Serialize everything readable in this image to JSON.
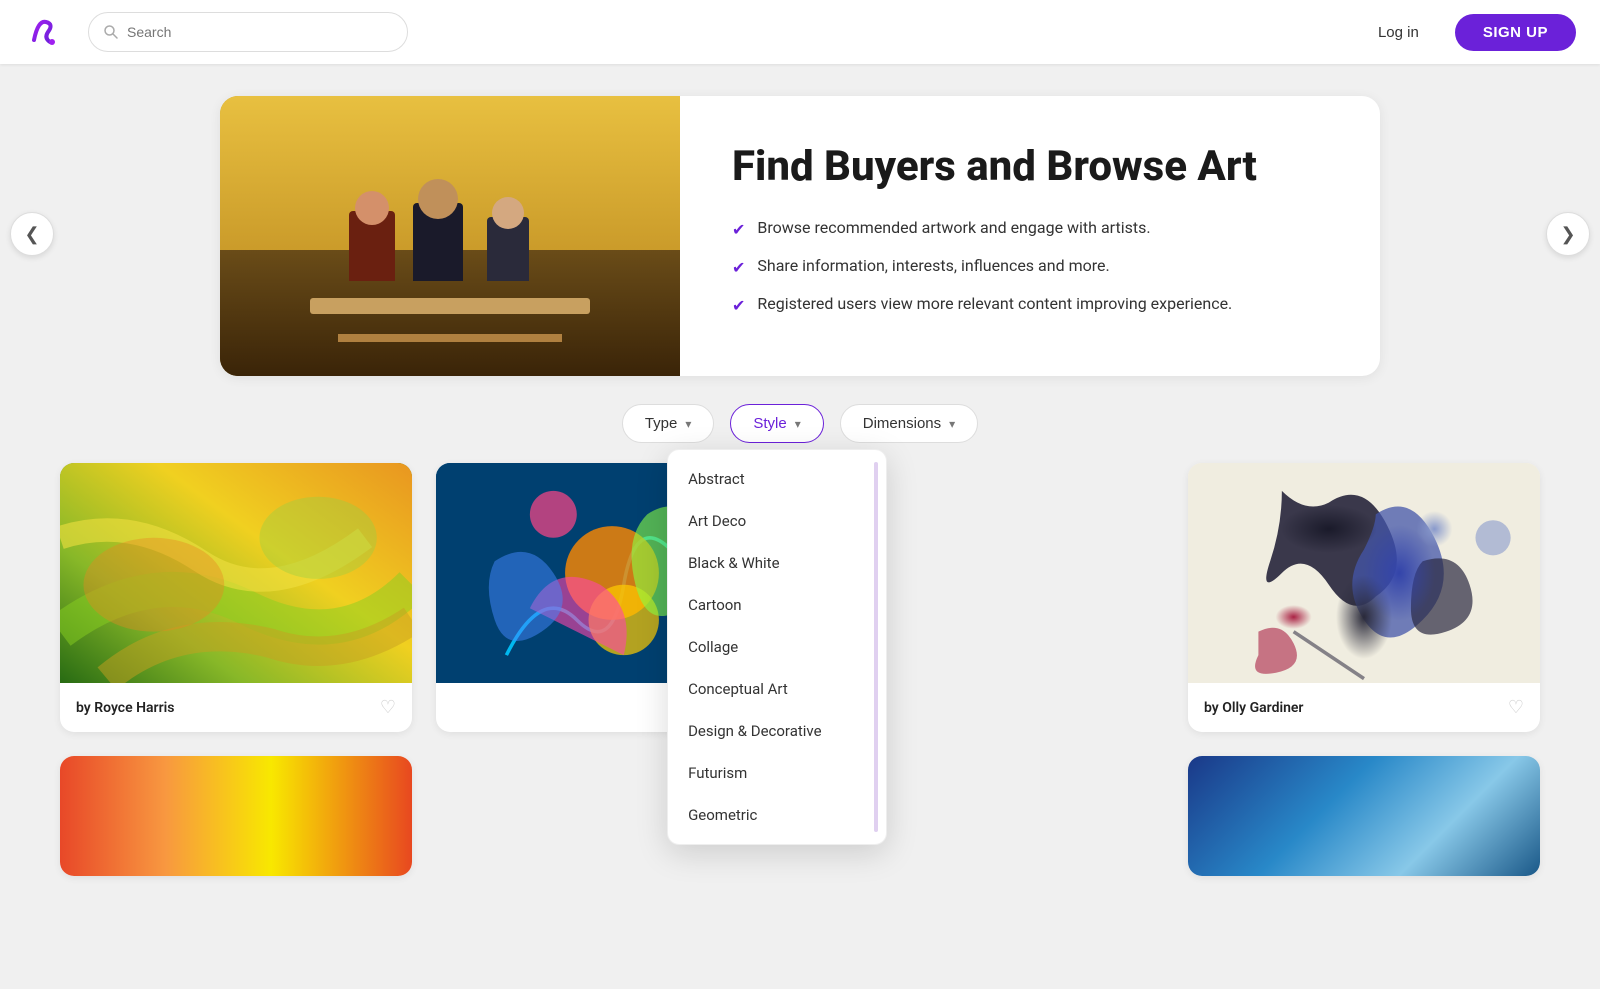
{
  "header": {
    "logo_alt": "Zatista logo",
    "search_placeholder": "Search",
    "login_label": "Log in",
    "signup_label": "SIGN UP"
  },
  "hero": {
    "title": "Find Buyers and Browse Art",
    "bullets": [
      "Browse recommended artwork and engage with artists.",
      "Share information, interests, influences and more.",
      "Registered users view more relevant content improving experience."
    ],
    "prev_arrow": "‹",
    "next_arrow": "›"
  },
  "filters": [
    {
      "id": "type",
      "label": "Type"
    },
    {
      "id": "style",
      "label": "Style"
    },
    {
      "id": "dimensions",
      "label": "Dimensions"
    }
  ],
  "style_dropdown": {
    "items": [
      "Abstract",
      "Art Deco",
      "Black & White",
      "Cartoon",
      "Collage",
      "Conceptual Art",
      "Design & Decorative",
      "Futurism",
      "Geometric"
    ]
  },
  "artworks": [
    {
      "artist_label": "by",
      "artist_name": "Royce Harris"
    },
    {
      "artist_label": "",
      "artist_name": ""
    },
    {
      "artist_label": "by",
      "artist_name": "Olly Gardiner"
    }
  ],
  "icons": {
    "search": "🔍",
    "chevron_down": "▾",
    "checkmark": "✔",
    "heart": "♡",
    "prev": "❮",
    "next": "❯"
  }
}
